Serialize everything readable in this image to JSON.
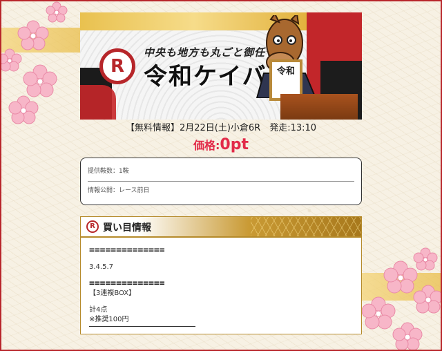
{
  "banner": {
    "slogan": "中央も地方も丸ごと御任せ!",
    "brand": "令和ケイバ",
    "logo_letter": "R",
    "sign_text": "令和"
  },
  "race": {
    "info": "【無料情報】2月22日(土)小倉6R　発走:13:10",
    "price_label": "価格:",
    "price_value": "0pt"
  },
  "details": [
    {
      "text": "提供鞍数：1鞍"
    },
    {
      "text": "情報公開：レース前日"
    }
  ],
  "buy": {
    "title": "買い目情報",
    "icon_letter": "R",
    "separator1": "==============",
    "numbers": "3.4.5.7",
    "separator2": "==============",
    "type": "【3連複BOX】",
    "total": "計4点",
    "recommend": "※推奨100円"
  },
  "colors": {
    "accent_red": "#b7262a",
    "price_pink": "#e22a48",
    "gold": "#b58a2a",
    "background": "#f7f1e4"
  }
}
